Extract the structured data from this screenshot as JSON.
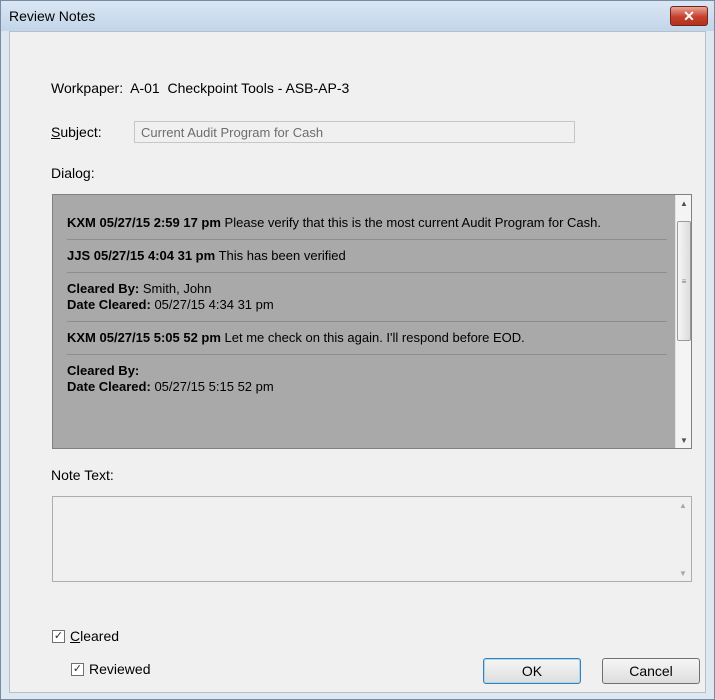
{
  "window": {
    "title": "Review Notes",
    "close_glyph": "✕"
  },
  "workpaper": {
    "text": "Workpaper:  A-01  Checkpoint Tools - ASB-AP-3"
  },
  "subject": {
    "label": "Subject:",
    "value": "Current Audit Program for Cash"
  },
  "dialog": {
    "label": "Dialog:",
    "entries": [
      {
        "head": "KXM 05/27/15 2:59 17 pm",
        "text": "Please verify that this is the most current Audit Program for Cash."
      },
      {
        "head": "JJS 05/27/15 4:04 31 pm",
        "text": "This has been verified"
      },
      {
        "cleared_by_label": "Cleared By:",
        "cleared_by": "Smith, John",
        "date_cleared_label": "Date Cleared:",
        "date_cleared": "05/27/15 4:34 31 pm"
      },
      {
        "head": "KXM 05/27/15 5:05 52 pm",
        "text": "Let me check on this again. I'll respond before EOD."
      },
      {
        "cleared_by_label": "Cleared By:",
        "cleared_by": "",
        "date_cleared_label": "Date Cleared:",
        "date_cleared": "05/27/15 5:15 52 pm"
      }
    ],
    "scrollbar": {
      "up_glyph": "▲",
      "down_glyph": "▼",
      "thumb_glyph": "≡"
    }
  },
  "note": {
    "label": "Note Text:",
    "value": "",
    "scrollbar": {
      "up_glyph": "▲",
      "down_glyph": "▼"
    }
  },
  "checkboxes": {
    "cleared": {
      "label": "Cleared",
      "checked": true,
      "check_glyph": "✓"
    },
    "reviewed": {
      "label": "Reviewed",
      "checked": true,
      "check_glyph": "✓"
    }
  },
  "buttons": {
    "ok": "OK",
    "cancel": "Cancel"
  },
  "colors": {
    "dialog_background": "#a9a9a9",
    "client_background": "#f0f0f0",
    "titlebar": "#c3d5ea",
    "close_button": "#c4402c"
  },
  "icons": {
    "close": "close-icon",
    "scroll_up": "chevron-up-icon",
    "scroll_down": "chevron-down-icon",
    "check": "check-icon"
  }
}
